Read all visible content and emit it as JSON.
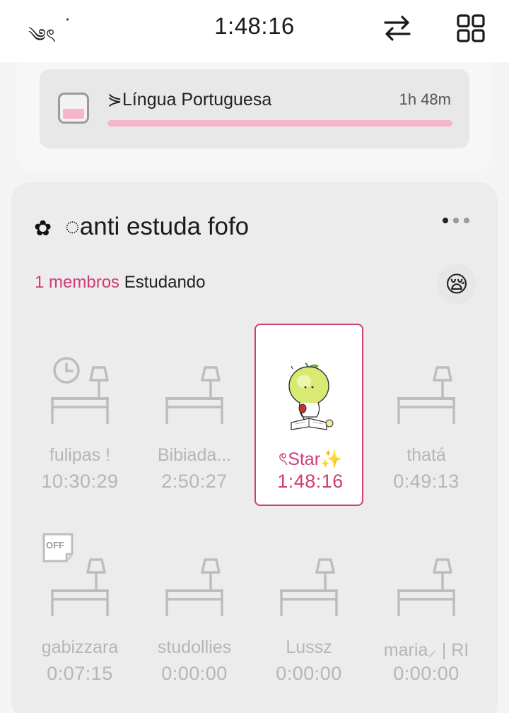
{
  "topbar": {
    "left_label": "༄ৎ",
    "timer": "1:48:16"
  },
  "subject": {
    "name": "⋟Língua Portuguesa",
    "time": "1h 48m",
    "progress": 1.0,
    "color": "#f6b5cb"
  },
  "group": {
    "flower": "✿",
    "title": "◌anti estuda fofo",
    "members_count": "1 membros",
    "members_state": "Estudando",
    "status_emoji": "😪",
    "accent": "#d03c78"
  },
  "seats": [
    {
      "name": "fulipas !",
      "time": "10:30:29",
      "badge": "clock-icon",
      "active": false
    },
    {
      "name": "Bibiada...",
      "time": "2:50:27",
      "badge": "",
      "active": false
    },
    {
      "name": "ৎStar✨",
      "time": "1:48:16",
      "badge": "",
      "active": true
    },
    {
      "name": "thatá",
      "time": "0:49:13",
      "badge": "",
      "active": false
    },
    {
      "name": "gabizzara",
      "time": "0:07:15",
      "badge": "off-note-icon",
      "badge_text": "OFF",
      "active": false
    },
    {
      "name": "studollies",
      "time": "0:00:00",
      "badge": "",
      "active": false
    },
    {
      "name": "Lussz",
      "time": "0:00:00",
      "badge": "",
      "active": false
    },
    {
      "name": "maria⸝ | RI",
      "time": "0:00:00",
      "badge": "",
      "active": false
    }
  ]
}
